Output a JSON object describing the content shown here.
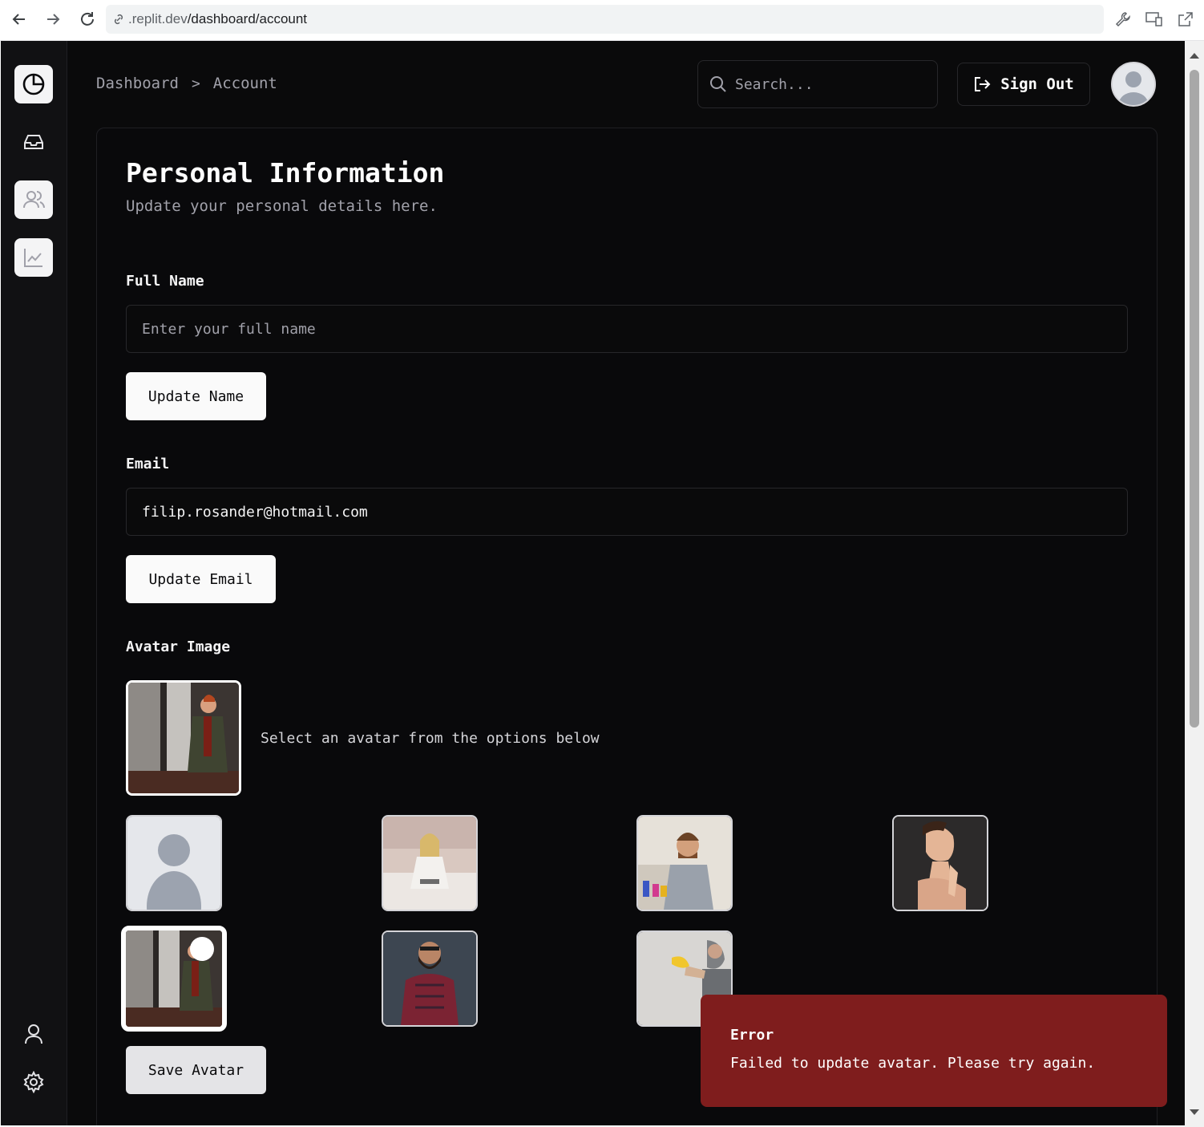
{
  "browser": {
    "url_host": ".replit.dev",
    "url_path": "/dashboard/account"
  },
  "breadcrumb": {
    "root": "Dashboard",
    "separator": ">",
    "current": "Account"
  },
  "header": {
    "search_placeholder": "Search...",
    "sign_out_label": "Sign Out"
  },
  "sidebar": {
    "items": [
      {
        "icon": "pie-chart-icon",
        "active": true
      },
      {
        "icon": "inbox-icon",
        "active": false
      },
      {
        "icon": "users-icon",
        "active": true
      },
      {
        "icon": "line-chart-icon",
        "active": true
      }
    ],
    "bottom": [
      {
        "icon": "user-icon"
      },
      {
        "icon": "gear-icon"
      }
    ]
  },
  "form": {
    "title": "Personal Information",
    "subtitle": "Update your personal details here.",
    "full_name_label": "Full Name",
    "full_name_placeholder": "Enter your full name",
    "full_name_value": "",
    "update_name_label": "Update Name",
    "email_label": "Email",
    "email_value": "filip.rosander@hotmail.com",
    "update_email_label": "Update Email",
    "avatar_label": "Avatar Image",
    "avatar_hint": "Select an avatar from the options below",
    "save_avatar_label": "Save Avatar",
    "avatar_options": [
      {
        "kind": "default-silhouette",
        "selected": false
      },
      {
        "kind": "photo-woman-on-bed-with-laptop",
        "selected": false
      },
      {
        "kind": "photo-bearded-man-at-desk",
        "selected": false
      },
      {
        "kind": "photo-woman-hand-on-neck",
        "selected": false
      },
      {
        "kind": "photo-person-in-green-coat",
        "selected": true
      },
      {
        "kind": "photo-bearded-man-plaid-shirt",
        "selected": false
      },
      {
        "kind": "photo-man-holding-banana",
        "selected": false
      }
    ]
  },
  "toast": {
    "title": "Error",
    "message": "Failed to update avatar. Please try again.",
    "color": "#7f1d1d"
  }
}
